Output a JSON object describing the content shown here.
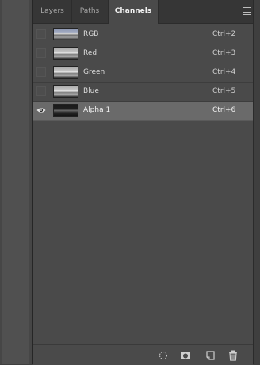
{
  "tabs": [
    {
      "label": "Layers",
      "active": false
    },
    {
      "label": "Paths",
      "active": false
    },
    {
      "label": "Channels",
      "active": true
    }
  ],
  "channels": [
    {
      "name": "RGB",
      "shortcut": "Ctrl+2",
      "visible": false,
      "selected": false,
      "thumb": "color"
    },
    {
      "name": "Red",
      "shortcut": "Ctrl+3",
      "visible": false,
      "selected": false,
      "thumb": "mono"
    },
    {
      "name": "Green",
      "shortcut": "Ctrl+4",
      "visible": false,
      "selected": false,
      "thumb": "mono"
    },
    {
      "name": "Blue",
      "shortcut": "Ctrl+5",
      "visible": false,
      "selected": false,
      "thumb": "mono"
    },
    {
      "name": "Alpha 1",
      "shortcut": "Ctrl+6",
      "visible": true,
      "selected": true,
      "thumb": "alpha"
    }
  ],
  "bottom_icons": [
    "load-channel-as-selection-icon",
    "save-selection-as-channel-icon",
    "new-channel-icon",
    "delete-channel-icon"
  ],
  "colors": {
    "panel_bg": "#4a4a4a",
    "tabbar_bg": "#363636",
    "selected_row": "#6a6a6a"
  }
}
